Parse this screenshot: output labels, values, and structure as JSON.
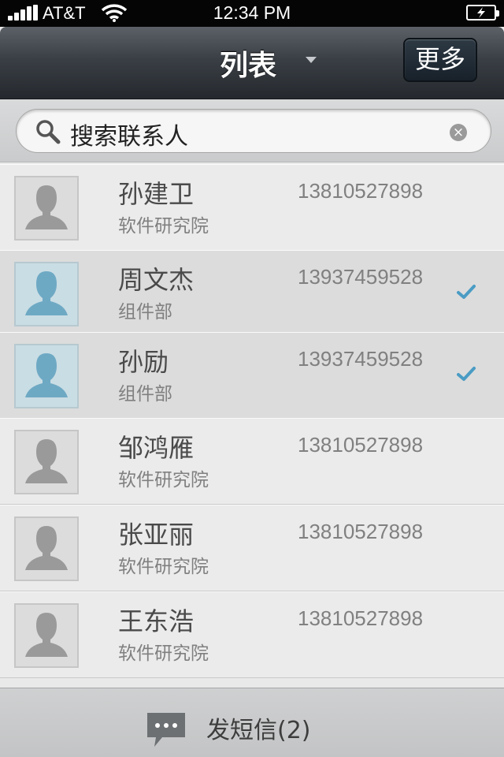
{
  "status_bar": {
    "carrier": "AT&T",
    "time": "12:34 PM",
    "battery_state": "charging"
  },
  "nav": {
    "title": "列表",
    "more_label": "更多"
  },
  "search": {
    "placeholder": "搜索联系人"
  },
  "contacts": [
    {
      "name": "孙建卫",
      "department": "软件研究院",
      "phone": "13810527898",
      "selected": false
    },
    {
      "name": "周文杰",
      "department": "组件部",
      "phone": "13937459528",
      "selected": true
    },
    {
      "name": "孙励",
      "department": "组件部",
      "phone": "13937459528",
      "selected": true
    },
    {
      "name": "邹鸿雁",
      "department": "软件研究院",
      "phone": "13810527898",
      "selected": false
    },
    {
      "name": "张亚丽",
      "department": "软件研究院",
      "phone": "13810527898",
      "selected": false
    },
    {
      "name": "王东浩",
      "department": "软件研究院",
      "phone": "13810527898",
      "selected": false
    }
  ],
  "bottom_bar": {
    "send_sms_label": "发短信(2)"
  },
  "colors": {
    "check": "#4a9cc4",
    "selected_avatar": "#6ea9c4",
    "default_avatar": "#9a9a9a"
  },
  "icons": [
    "signal-icon",
    "wifi-icon",
    "battery-icon",
    "search-icon",
    "clear-icon",
    "avatar-icon",
    "check-icon",
    "sms-icon"
  ]
}
